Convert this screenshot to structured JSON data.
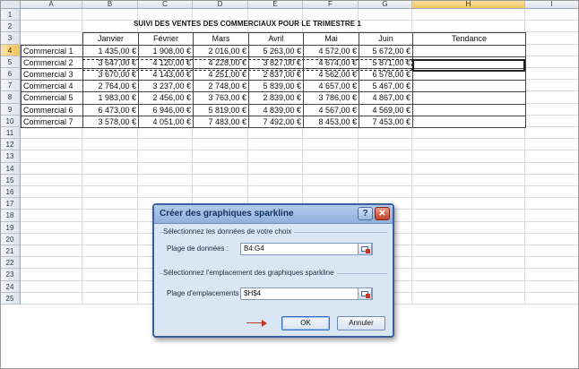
{
  "sheet": {
    "columns": [
      "A",
      "B",
      "C",
      "D",
      "E",
      "F",
      "G",
      "H",
      "I"
    ],
    "selected_column": "H",
    "rows": [
      "1",
      "2",
      "3",
      "4",
      "5",
      "6",
      "7",
      "8",
      "9",
      "10",
      "11",
      "12",
      "13",
      "14",
      "15",
      "16",
      "17",
      "18",
      "19",
      "20",
      "21",
      "22",
      "23",
      "24",
      "25"
    ],
    "selected_row": "4",
    "title": "SUIVI DES VENTES DES COMMERCIAUX POUR LE TRIMESTRE 1",
    "headers": [
      "Janvier",
      "Février",
      "Mars",
      "Avril",
      "Mai",
      "Juin",
      "Tendance"
    ],
    "table": [
      {
        "name": "Commercial 1",
        "values": [
          "1 435,00 €",
          "1 908,00 €",
          "2 016,00 €",
          "5 263,00 €",
          "4 572,00 €",
          "5 672,00 €"
        ]
      },
      {
        "name": "Commercial 2",
        "values": [
          "3 647,00 €",
          "4 120,00 €",
          "4 228,00 €",
          "3 827,00 €",
          "4 674,00 €",
          "5 871,00 €"
        ]
      },
      {
        "name": "Commercial 3",
        "values": [
          "3 670,00 €",
          "4 143,00 €",
          "4 251,00 €",
          "2 837,00 €",
          "4 562,00 €",
          "6 578,00 €"
        ]
      },
      {
        "name": "Commercial 4",
        "values": [
          "2 764,00 €",
          "3 237,00 €",
          "2 748,00 €",
          "5 839,00 €",
          "4 657,00 €",
          "5 467,00 €"
        ]
      },
      {
        "name": "Commercial 5",
        "values": [
          "1 983,00 €",
          "2 456,00 €",
          "3 763,00 €",
          "2 839,00 €",
          "3 786,00 €",
          "4 867,00 €"
        ]
      },
      {
        "name": "Commercial 6",
        "values": [
          "6 473,00 €",
          "6 946,00 €",
          "5 819,00 €",
          "4 839,00 €",
          "4 567,00 €",
          "4 569,00 €"
        ]
      },
      {
        "name": "Commercial 7",
        "values": [
          "3 578,00 €",
          "4 051,00 €",
          "7 483,00 €",
          "7 492,00 €",
          "8 453,00 €",
          "7 453,00 €"
        ]
      }
    ]
  },
  "dialog": {
    "title": "Créer des graphiques sparkline",
    "help_label": "?",
    "close_label": "✕",
    "group1_label": "Sélectionnez les données de votre choix",
    "data_range_label": "Plage de données :",
    "data_range_value": "B4:G4",
    "group2_label": "Sélectionnez l'emplacement des graphiques sparkline",
    "location_range_label": "Plage d'emplacements :",
    "location_range_value": "$H$4",
    "ok_label": "OK",
    "cancel_label": "Annuler",
    "range_button_icon": "collapse-dialog-icon",
    "arrow_color": "#c0392b"
  }
}
